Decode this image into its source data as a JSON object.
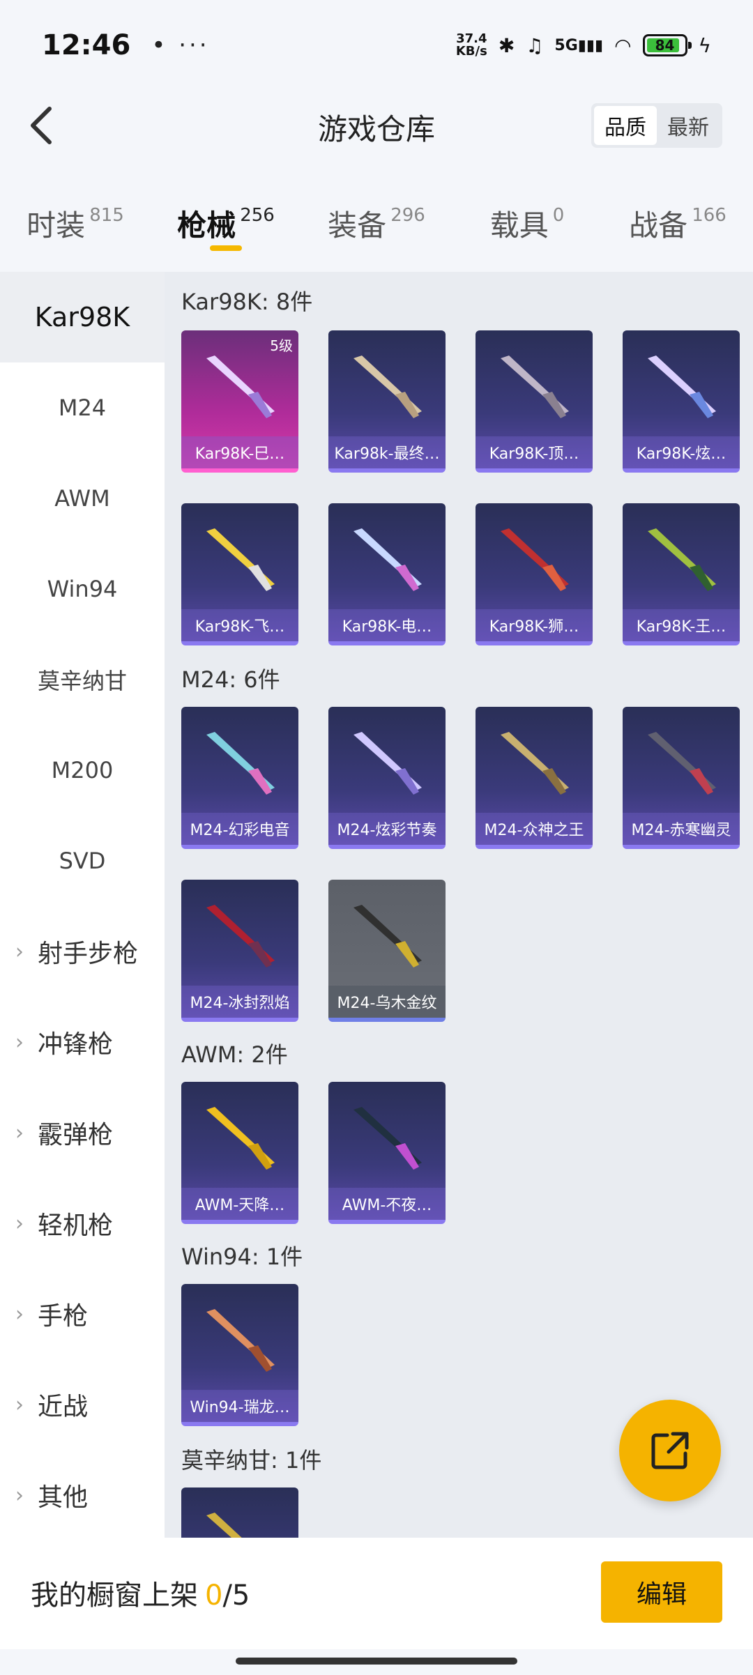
{
  "status": {
    "time": "12:46",
    "net_speed": "37.4 KB/s",
    "signal": "5G",
    "battery": "84"
  },
  "header": {
    "title": "游戏仓库",
    "sort_options": [
      "品质",
      "最新"
    ]
  },
  "tabs": [
    {
      "label": "时装",
      "count": "815"
    },
    {
      "label": "枪械",
      "count": "256"
    },
    {
      "label": "装备",
      "count": "296"
    },
    {
      "label": "载具",
      "count": "0"
    },
    {
      "label": "战备",
      "count": "166"
    }
  ],
  "sidebar": [
    "Kar98K",
    "M24",
    "AWM",
    "Win94",
    "莫辛纳甘",
    "M200",
    "SVD",
    "射手步枪",
    "冲锋枪",
    "霰弹枪",
    "轻机枪",
    "手枪",
    "近战",
    "其他"
  ],
  "sections": [
    {
      "title": "Kar98K: 8件",
      "items": [
        "Kar98K-巳…",
        "Kar98k-最终…",
        "Kar98K-顶…",
        "Kar98K-炫…",
        "Kar98K-飞…",
        "Kar98K-电…",
        "Kar98K-狮…",
        "Kar98K-王…"
      ],
      "level_badge": "5级"
    },
    {
      "title": "M24: 6件",
      "items": [
        "M24-幻彩电音",
        "M24-炫彩节奏",
        "M24-众神之王",
        "M24-赤寒幽灵",
        "M24-冰封烈焰",
        "M24-乌木金纹"
      ]
    },
    {
      "title": "AWM: 2件",
      "items": [
        "AWM-天降…",
        "AWM-不夜…"
      ]
    },
    {
      "title": "Win94: 1件",
      "items": [
        "Win94-瑞龙…"
      ]
    },
    {
      "title": "莫辛纳甘: 1件",
      "items": [
        ""
      ]
    }
  ],
  "bottom": {
    "shelf_label": "我的橱窗上架",
    "shelf_current": "0",
    "shelf_total": "/5",
    "edit_label": "编辑"
  },
  "colors": {
    "accent": "#f5b300",
    "card_purple": "#3a3a7a",
    "card_pink": "#b02c9a",
    "card_grey": "#6a6e76"
  }
}
